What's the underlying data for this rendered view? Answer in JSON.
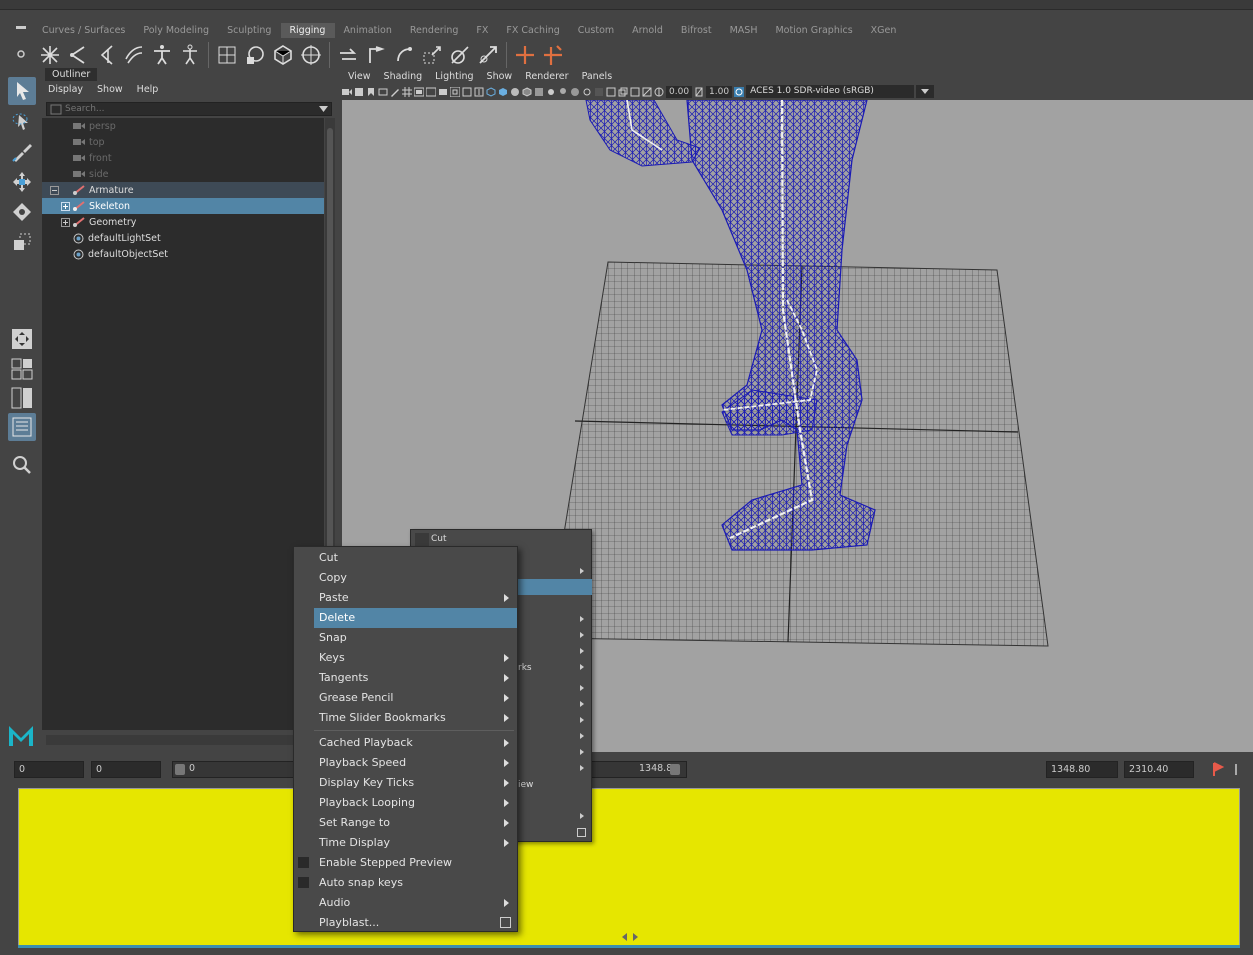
{
  "shelf": {
    "tabs": [
      "Curves / Surfaces",
      "Poly Modeling",
      "Sculpting",
      "Rigging",
      "Animation",
      "Rendering",
      "FX",
      "FX Caching",
      "Custom",
      "Arnold",
      "Bifrost",
      "MASH",
      "Motion Graphics",
      "XGen"
    ],
    "active_tab": "Rigging"
  },
  "outliner": {
    "tab_label": "Outliner",
    "menu": [
      "Display",
      "Show",
      "Help"
    ],
    "search_placeholder": "Search...",
    "items": [
      {
        "label": "persp",
        "icon": "camera-icon",
        "state": "dim"
      },
      {
        "label": "top",
        "icon": "camera-icon",
        "state": "dim"
      },
      {
        "label": "front",
        "icon": "camera-icon",
        "state": "dim"
      },
      {
        "label": "side",
        "icon": "camera-icon",
        "state": "dim"
      },
      {
        "label": "Armature",
        "icon": "joint-icon",
        "state": "highlight",
        "expander": "minus"
      },
      {
        "label": "Skeleton",
        "icon": "joint-icon",
        "state": "selected",
        "expander": "plus"
      },
      {
        "label": "Geometry",
        "icon": "joint-icon",
        "state": "normal",
        "expander": "plus"
      },
      {
        "label": "defaultLightSet",
        "icon": "set-icon",
        "state": "normal"
      },
      {
        "label": "defaultObjectSet",
        "icon": "set-icon",
        "state": "normal"
      }
    ]
  },
  "viewport": {
    "menu": [
      "View",
      "Shading",
      "Lighting",
      "Show",
      "Renderer",
      "Panels"
    ],
    "exposure": "0.00",
    "gamma": "1.00",
    "color_space": "ACES 1.0 SDR-video (sRGB)"
  },
  "timebar": {
    "start": "0",
    "anim_start": "0",
    "range_start": "0",
    "range_end": "1348.8",
    "playback_end": "1348.80",
    "anim_end": "2310.40"
  },
  "back_menu": {
    "first_item": "Cut",
    "partial_item_1": "rks",
    "partial_item_2": "iew"
  },
  "context_menu": {
    "items": [
      {
        "label": "Cut"
      },
      {
        "label": "Copy"
      },
      {
        "label": "Paste",
        "submenu": true
      },
      {
        "label": "Delete",
        "highlight": true
      },
      {
        "label": "Snap"
      },
      {
        "label": "Keys",
        "submenu": true
      },
      {
        "label": "Tangents",
        "submenu": true
      },
      {
        "label": "Grease Pencil",
        "submenu": true
      },
      {
        "label": "Time Slider Bookmarks",
        "submenu": true
      },
      {
        "label": "Cached Playback",
        "submenu": true
      },
      {
        "label": "Playback Speed",
        "submenu": true
      },
      {
        "label": "Display Key Ticks",
        "submenu": true
      },
      {
        "label": "Playback Looping",
        "submenu": true
      },
      {
        "label": "Set Range to",
        "submenu": true
      },
      {
        "label": "Time Display",
        "submenu": true
      },
      {
        "label": "Enable Stepped Preview",
        "checkbox": true
      },
      {
        "label": "Auto snap keys",
        "checkbox": true
      },
      {
        "label": "Audio",
        "submenu": true
      },
      {
        "label": "Playblast...",
        "option_box": true
      }
    ]
  },
  "colors": {
    "selection": "#5285a6",
    "timeline": "#e6e600",
    "wireframe": "#1a1ab4",
    "viewport_bg": "#a2a2a2"
  }
}
